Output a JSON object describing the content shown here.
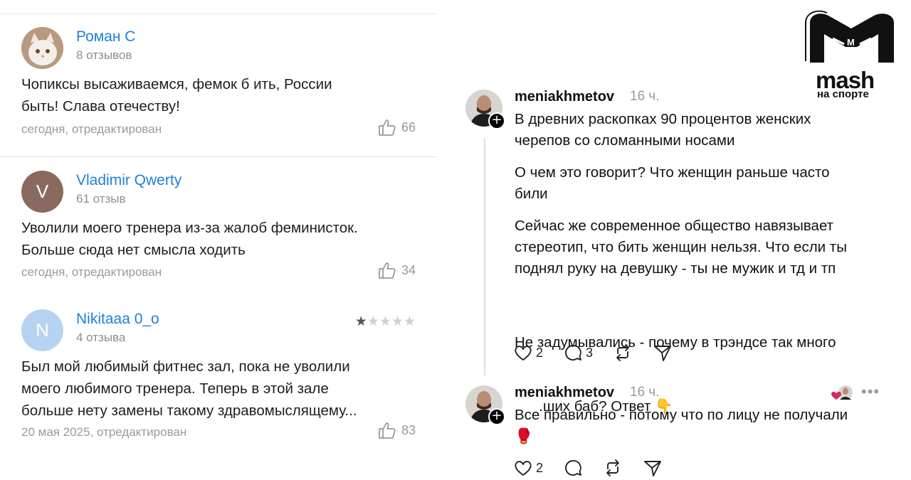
{
  "reviews": [
    {
      "author": "Роман С",
      "count": "8 отзывов",
      "text_lines": [
        "Чопиксы высаживаемся, фемок б ить, России",
        "быть! Слава отечеству!"
      ],
      "meta": "сегодня, отредактирован",
      "likes": "66"
    },
    {
      "author": "Vladimir Qwerty",
      "initial": "V",
      "count": "61 отзыв",
      "text_lines": [
        "Уволили моего тренера из-за жалоб феминисток.",
        "Больше сюда нет смысла ходить"
      ],
      "meta": "сегодня, отредактирован",
      "likes": "34"
    },
    {
      "author": "Nikitaaa 0_o",
      "initial": "N",
      "count": "4 отзыва",
      "rating": 1,
      "rating_max": 5,
      "text_lines": [
        "Был мой любимый фитнес зал, пока не уволили",
        "моего любимого тренера. Теперь в этой зале",
        "больше нету замены такому здравомыслящему..."
      ],
      "meta": "20 мая 2025, отредактирован",
      "likes": "83"
    }
  ],
  "logo": {
    "word": "mash",
    "sub": "на спорте"
  },
  "posts": [
    {
      "username": "meniakhmetov",
      "time": "16 ч.",
      "paragraphs": [
        [
          "В древних раскопках 90 процентов женских",
          "черепов со сломанными носами"
        ],
        [
          "О чем это говорит? Что женщин раньше часто",
          "били"
        ],
        [
          "Сейчас же современное общество навязывает",
          "стереотип, что бить женщин нельзя. Что если ты",
          "поднял руку на девушку - ты не мужик и тд и тп"
        ],
        [
          "Не задумывались - почему в трэндсе так много",
          "      .ших баб? Ответ 👇"
        ]
      ],
      "likes": "2",
      "comments": "3"
    },
    {
      "username": "meniakhmetov",
      "time": "16 ч.",
      "paragraphs": [
        [
          "Все правильно - потому что по лицу не получали",
          "🥊"
        ]
      ],
      "likes": "2",
      "comments": ""
    }
  ],
  "colors": {
    "link": "#1f7fdb",
    "muted": "#9a9a9a",
    "avatar_v": "#8a6a5e",
    "avatar_n": "#b7d3f2"
  },
  "icons": [
    "thumbs-up-icon",
    "star-icon",
    "heart-icon",
    "comment-icon",
    "repost-icon",
    "share-icon",
    "follow-plus-icon",
    "more-icon"
  ]
}
